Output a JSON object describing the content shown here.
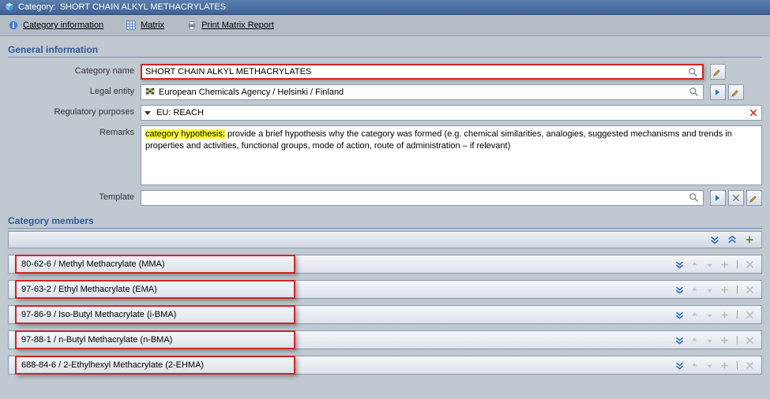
{
  "titlebar": {
    "prefix": "Category:",
    "name": "SHORT CHAIN ALKYL METHACRYLATES"
  },
  "toolbar": {
    "cat_info": "Category information",
    "matrix": "Matrix",
    "print": "Print Matrix Report"
  },
  "sections": {
    "general": "General information",
    "members": "Category members"
  },
  "labels": {
    "category_name": "Category name",
    "legal_entity": "Legal entity",
    "regulatory_purposes": "Regulatory purposes",
    "remarks": "Remarks",
    "template": "Template"
  },
  "fields": {
    "category_name": "SHORT CHAIN ALKYL METHACRYLATES",
    "legal_entity": "European Chemicals Agency / Helsinki / Finland",
    "regulatory_purposes": "EU: REACH",
    "remarks_hi": "category hypothesis:",
    "remarks_rest": " provide a brief hypothesis why the category was formed  (e.g. chemical similarities, analogies, suggested mechanisms and trends in properties and activities, functional groups, mode of action, route of administration – if relevant)",
    "template": ""
  },
  "members": [
    "80-62-6 / Methyl Methacrylate (MMA)",
    "97-63-2 / Ethyl Methacrylate (EMA)",
    "97-86-9 / Iso-Butyl Methacrylate (i-BMA)",
    "97-88-1 / n-Butyl Methacrylate (n-BMA)",
    "688-84-6 / 2-Ethylhexyl Methacrylate (2-EHMA)"
  ]
}
